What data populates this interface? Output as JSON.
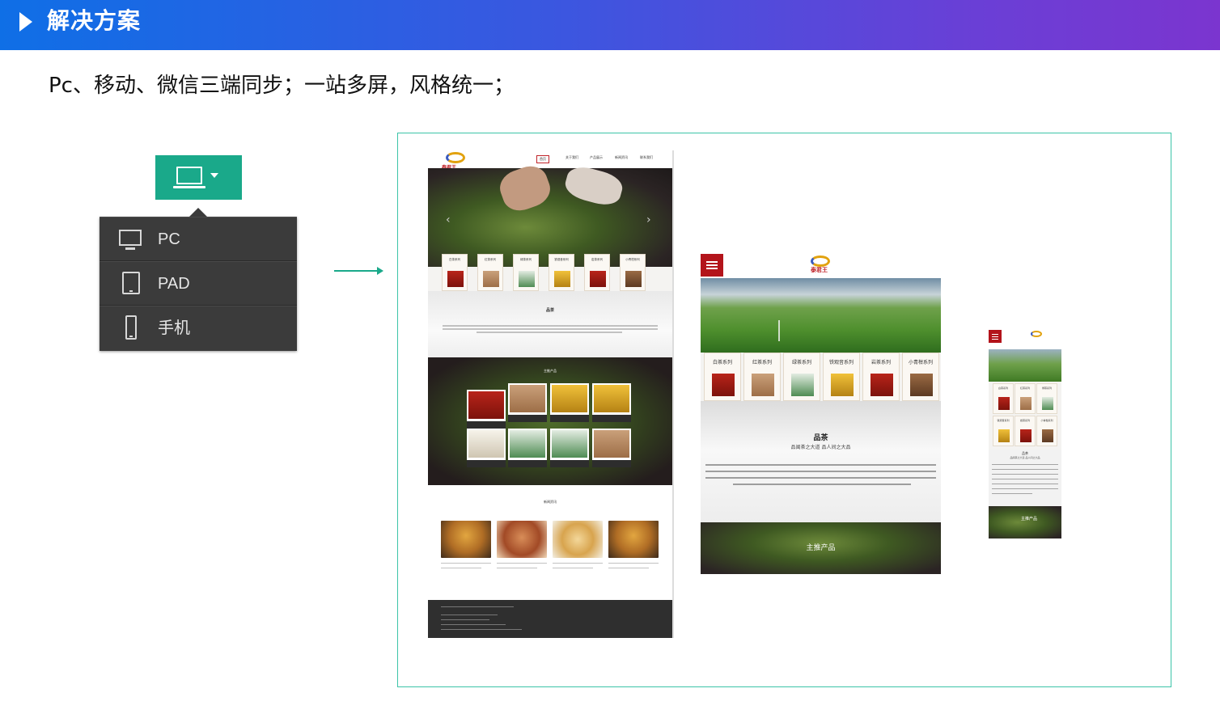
{
  "header": {
    "title": "解决方案"
  },
  "subtitle": "Pc、移动、微信三端同步；一站多屏，风格统一；",
  "device_switcher": {
    "items": [
      {
        "label": "PC",
        "icon": "monitor-icon"
      },
      {
        "label": "PAD",
        "icon": "tablet-icon"
      },
      {
        "label": "手机",
        "icon": "phone-icon"
      }
    ]
  },
  "colors": {
    "banner_start": "#0f6fe6",
    "banner_end": "#7b35cf",
    "accent": "#1aa98a",
    "brand_red": "#b3141b"
  },
  "pc_mock": {
    "brand": "泰君王",
    "pinch_text": "品茶",
    "product_heading": "主推产品",
    "news_heading": "新闻资讯"
  },
  "pad_mock": {
    "brand": "泰君王",
    "categories": [
      "白茶系列",
      "红茶系列",
      "绿茶系列",
      "铁观音系列",
      "岩茶系列",
      "小青柑系列"
    ],
    "pinch_title": "品茶",
    "pinch_sub": "品闽茶之大道 品人间之大品",
    "paragraph": "厦门泰君王茶叶有限公司创办于泰君王最东部的一座茶山，拥有20多年茶山800余亩，地处世界文化与自然遗产——武夷山景区山泉地带，环境独特优美适合茶树生长，原生态茶园集聚山体——生产天然有机绿色茶品，坚持好茶原产地茶树种植，茶叶品质极佳。",
    "product_heading": "主推产品"
  },
  "phone_mock": {
    "categories": [
      "白茶系列",
      "红茶系列",
      "绿茶系列",
      "铁观音系列",
      "岩茶系列",
      "小青柑系列"
    ],
    "pinch_title": "品茶",
    "pinch_sub": "品闽茶之大道 品人间之大品",
    "product_heading": "主推产品"
  }
}
